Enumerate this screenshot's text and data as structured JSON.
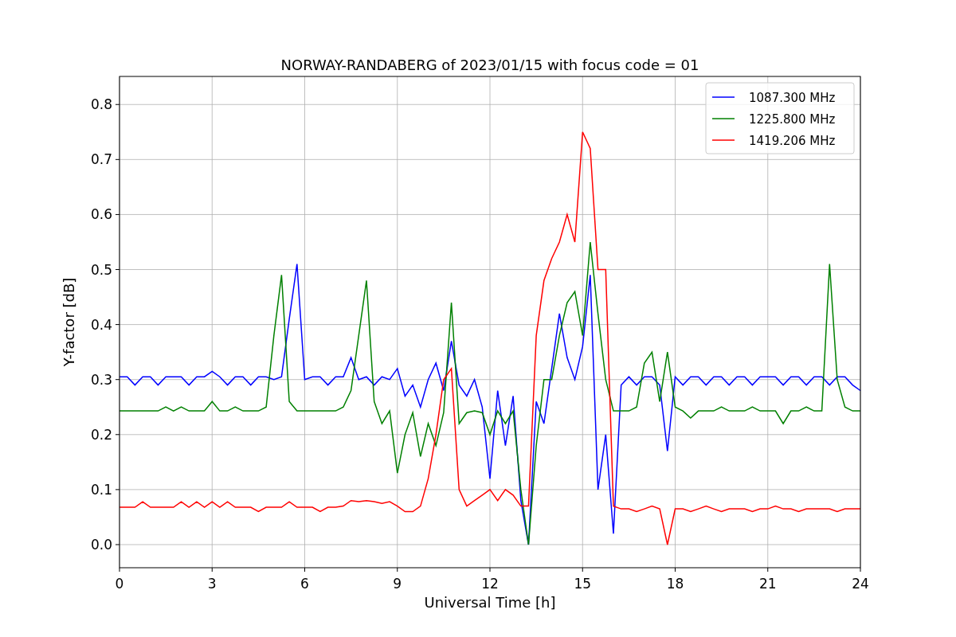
{
  "figure": {
    "chart_data": {
      "type": "line",
      "title": "NORWAY-RANDABERG of 2023/01/15 with focus code = 01",
      "xlabel": "Universal Time [h]",
      "ylabel": "Y-factor [dB]",
      "grid": true,
      "legend": true,
      "xlim": [
        0,
        24
      ],
      "ylim": [
        -0.042,
        0.851
      ],
      "xticks": [
        0,
        3,
        6,
        9,
        12,
        15,
        18,
        21,
        24
      ],
      "yticks": [
        {
          "value": 0,
          "label": "0.0"
        },
        {
          "value": 0.1,
          "label": "0.1"
        },
        {
          "value": 0.2,
          "label": "0.2"
        },
        {
          "value": 0.3,
          "label": "0.3"
        },
        {
          "value": 0.4,
          "label": "0.4"
        },
        {
          "value": 0.5,
          "label": "0.5"
        },
        {
          "value": 0.6,
          "label": "0.6"
        },
        {
          "value": 0.7,
          "label": "0.7"
        },
        {
          "value": 0.8,
          "label": "0.8"
        }
      ],
      "x": [
        0,
        0.25,
        0.5,
        0.75,
        1,
        1.25,
        1.5,
        1.75,
        2,
        2.25,
        2.5,
        2.75,
        3,
        3.25,
        3.5,
        3.75,
        4,
        4.25,
        4.5,
        4.75,
        5,
        5.25,
        5.5,
        5.75,
        6,
        6.25,
        6.5,
        6.75,
        7,
        7.25,
        7.5,
        7.75,
        8,
        8.25,
        8.5,
        8.75,
        9,
        9.25,
        9.5,
        9.75,
        10,
        10.25,
        10.5,
        10.75,
        11,
        11.25,
        11.5,
        11.75,
        12,
        12.25,
        12.5,
        12.75,
        13,
        13.25,
        13.5,
        13.75,
        14,
        14.25,
        14.5,
        14.75,
        15,
        15.25,
        15.5,
        15.75,
        16,
        16.25,
        16.5,
        16.75,
        17,
        17.25,
        17.5,
        17.75,
        18,
        18.25,
        18.5,
        18.75,
        19,
        19.25,
        19.5,
        19.75,
        20,
        20.25,
        20.5,
        20.75,
        21,
        21.25,
        21.5,
        21.75,
        22,
        22.25,
        22.5,
        22.75,
        23,
        23.25,
        23.5,
        23.75,
        24
      ],
      "series": [
        {
          "name": "1087.300 MHz",
          "color": "#0000ff",
          "values": [
            0.305,
            0.305,
            0.29,
            0.305,
            0.305,
            0.29,
            0.305,
            0.305,
            0.305,
            0.29,
            0.305,
            0.305,
            0.315,
            0.305,
            0.29,
            0.305,
            0.305,
            0.29,
            0.305,
            0.305,
            0.3,
            0.305,
            0.41,
            0.51,
            0.3,
            0.305,
            0.305,
            0.29,
            0.305,
            0.305,
            0.34,
            0.3,
            0.305,
            0.29,
            0.305,
            0.3,
            0.32,
            0.27,
            0.29,
            0.25,
            0.3,
            0.33,
            0.28,
            0.37,
            0.29,
            0.27,
            0.3,
            0.25,
            0.12,
            0.28,
            0.18,
            0.27,
            0.08,
            0.0,
            0.26,
            0.22,
            0.32,
            0.42,
            0.34,
            0.3,
            0.36,
            0.49,
            0.1,
            0.2,
            0.02,
            0.29,
            0.305,
            0.29,
            0.305,
            0.305,
            0.29,
            0.17,
            0.305,
            0.29,
            0.305,
            0.305,
            0.29,
            0.305,
            0.305,
            0.29,
            0.305,
            0.305,
            0.29,
            0.305,
            0.305,
            0.305,
            0.29,
            0.305,
            0.305,
            0.29,
            0.305,
            0.305,
            0.29,
            0.305,
            0.305,
            0.29,
            0.28
          ]
        },
        {
          "name": "1225.800 MHz",
          "color": "#008000",
          "values": [
            0.243,
            0.243,
            0.243,
            0.243,
            0.243,
            0.243,
            0.25,
            0.243,
            0.25,
            0.243,
            0.243,
            0.243,
            0.26,
            0.243,
            0.243,
            0.25,
            0.243,
            0.243,
            0.243,
            0.25,
            0.38,
            0.49,
            0.26,
            0.243,
            0.243,
            0.243,
            0.243,
            0.243,
            0.243,
            0.25,
            0.28,
            0.38,
            0.48,
            0.26,
            0.22,
            0.243,
            0.13,
            0.2,
            0.24,
            0.16,
            0.22,
            0.18,
            0.24,
            0.44,
            0.22,
            0.24,
            0.243,
            0.24,
            0.2,
            0.243,
            0.22,
            0.243,
            0.1,
            0.0,
            0.18,
            0.3,
            0.3,
            0.38,
            0.44,
            0.46,
            0.38,
            0.55,
            0.42,
            0.3,
            0.243,
            0.243,
            0.243,
            0.25,
            0.33,
            0.35,
            0.26,
            0.35,
            0.25,
            0.243,
            0.23,
            0.243,
            0.243,
            0.243,
            0.25,
            0.243,
            0.243,
            0.243,
            0.25,
            0.243,
            0.243,
            0.243,
            0.22,
            0.243,
            0.243,
            0.25,
            0.243,
            0.243,
            0.51,
            0.3,
            0.25,
            0.243,
            0.243
          ]
        },
        {
          "name": "1419.206 MHz",
          "color": "#ff0000",
          "values": [
            0.068,
            0.068,
            0.068,
            0.078,
            0.068,
            0.068,
            0.068,
            0.068,
            0.078,
            0.068,
            0.078,
            0.068,
            0.078,
            0.068,
            0.078,
            0.068,
            0.068,
            0.068,
            0.06,
            0.068,
            0.068,
            0.068,
            0.078,
            0.068,
            0.068,
            0.068,
            0.06,
            0.068,
            0.068,
            0.07,
            0.08,
            0.078,
            0.08,
            0.078,
            0.075,
            0.078,
            0.07,
            0.06,
            0.06,
            0.07,
            0.12,
            0.2,
            0.3,
            0.32,
            0.1,
            0.07,
            0.08,
            0.09,
            0.1,
            0.08,
            0.1,
            0.09,
            0.07,
            0.07,
            0.38,
            0.48,
            0.52,
            0.55,
            0.6,
            0.55,
            0.75,
            0.72,
            0.5,
            0.5,
            0.07,
            0.065,
            0.065,
            0.06,
            0.065,
            0.07,
            0.065,
            0.0,
            0.065,
            0.065,
            0.06,
            0.065,
            0.07,
            0.065,
            0.06,
            0.065,
            0.065,
            0.065,
            0.06,
            0.065,
            0.065,
            0.07,
            0.065,
            0.065,
            0.06,
            0.065,
            0.065,
            0.065,
            0.065,
            0.06,
            0.065,
            0.065,
            0.065
          ]
        }
      ]
    }
  }
}
